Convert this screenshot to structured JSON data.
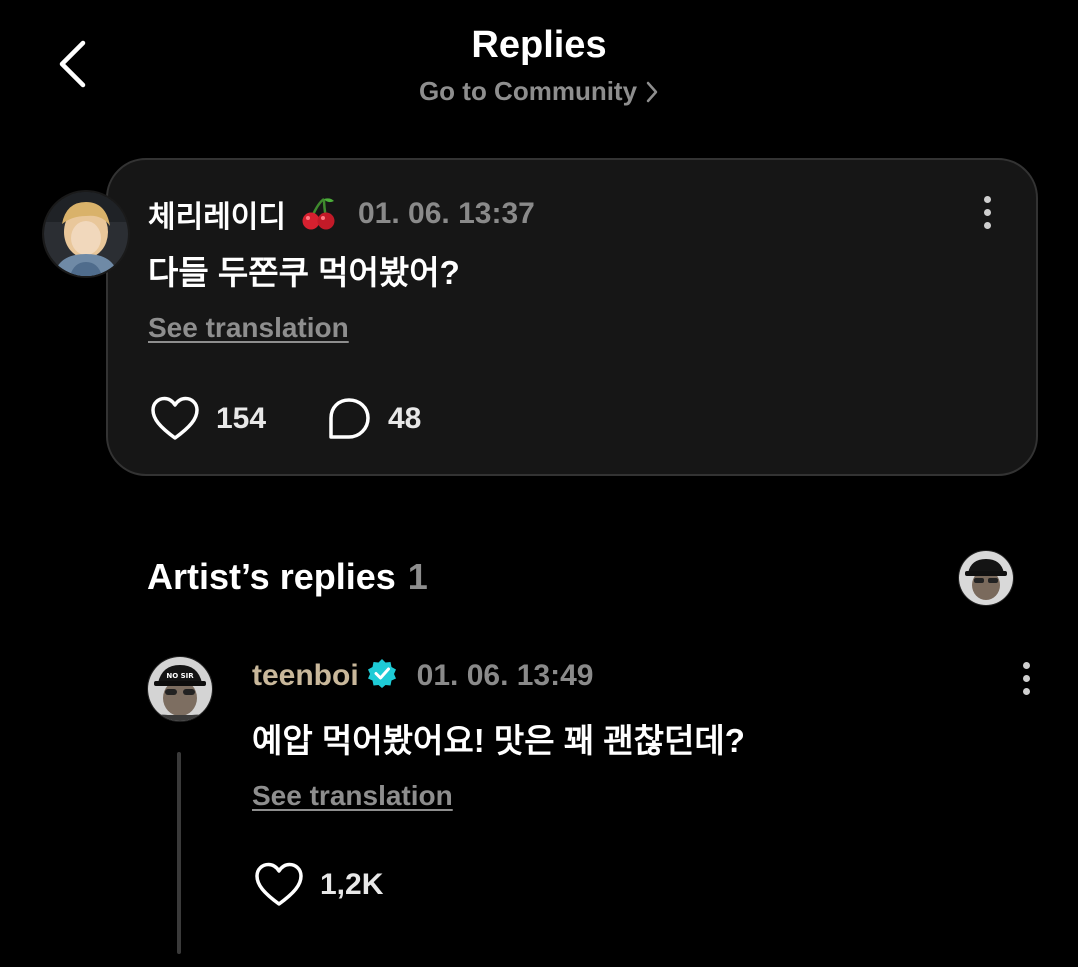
{
  "header": {
    "title": "Replies",
    "subtitle": "Go to Community"
  },
  "post": {
    "author": "체리레이디",
    "author_emoji": "cherry-icon",
    "time": "01. 06. 13:37",
    "text": "다들 두쫀쿠 먹어봤어?",
    "translate_label": "See translation",
    "likes": "154",
    "comments": "48"
  },
  "artist_section": {
    "title": "Artist’s replies",
    "count": "1"
  },
  "reply": {
    "author": "teenboi",
    "verified": "verified-badge-icon",
    "time": "01. 06. 13:49",
    "text": "예압 먹어봤어요! 맛은 꽤 괜찮던데?",
    "translate_label": "See translation",
    "likes": "1,2K",
    "name_color": "#c9b89b",
    "badge_color": "#1ecbd6"
  }
}
